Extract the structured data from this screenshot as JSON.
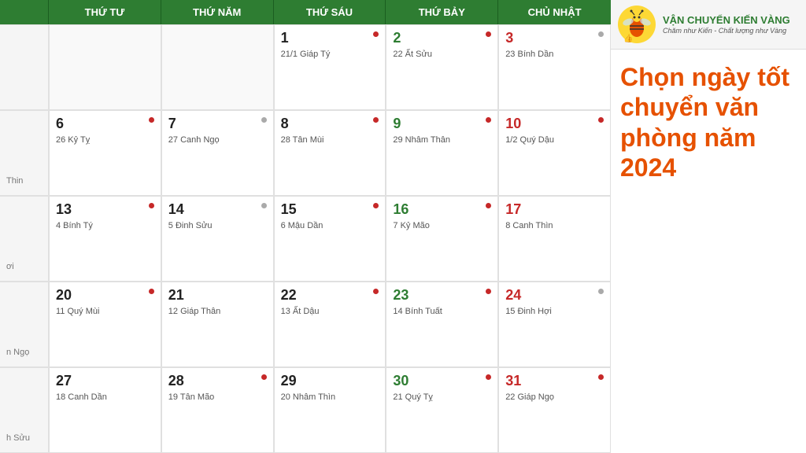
{
  "header": {
    "days": [
      "",
      "THỨ TƯ",
      "THỨ NĂM",
      "THỨ SÁU",
      "THỨ BẢY",
      "CHỦ NHẬT"
    ]
  },
  "logo": {
    "title": "VẬN CHUYỂN KIẾN VÀNG",
    "subtitle_line1": "Chăm như Kiến - Chất lượng như Vàng",
    "alt": "Logo Kiến Vàng"
  },
  "promo": {
    "text": "Chọn ngày tốt chuyển văn phòng năm 2024"
  },
  "rows": [
    {
      "partial": "",
      "cells": [
        {
          "day": "1",
          "lunar": "21/1 Giáp Tý",
          "dot": "red",
          "color": "normal"
        },
        {
          "day": "2",
          "lunar": "22 Ất Sửu",
          "dot": "red",
          "color": "green"
        },
        {
          "day": "3",
          "lunar": "23 Bính Dần",
          "dot": "gray",
          "color": "red"
        }
      ]
    },
    {
      "partial": "Thin",
      "cells": [
        {
          "day": "6",
          "lunar": "26 Kỷ Tỵ",
          "dot": "red",
          "color": "normal"
        },
        {
          "day": "7",
          "lunar": "27 Canh Ngọ",
          "dot": "gray",
          "color": "normal"
        },
        {
          "day": "8",
          "lunar": "28 Tân Mùi",
          "dot": "red",
          "color": "normal"
        },
        {
          "day": "9",
          "lunar": "29 Nhâm Thân",
          "dot": "red",
          "color": "green"
        },
        {
          "day": "10",
          "lunar": "1/2 Quý Dậu",
          "dot": "red",
          "color": "red"
        }
      ]
    },
    {
      "partial": "ơi",
      "cells": [
        {
          "day": "13",
          "lunar": "4 Bính Tý",
          "dot": "red",
          "color": "normal"
        },
        {
          "day": "14",
          "lunar": "5 Đinh Sửu",
          "dot": "gray",
          "color": "normal"
        },
        {
          "day": "15",
          "lunar": "6 Mậu Dần",
          "dot": "red",
          "color": "normal"
        },
        {
          "day": "16",
          "lunar": "7 Kỷ Mão",
          "dot": "red",
          "color": "green"
        },
        {
          "day": "17",
          "lunar": "8 Canh Thìn",
          "dot": "none",
          "color": "red"
        }
      ]
    },
    {
      "partial": "n Ngọ",
      "cells": [
        {
          "day": "20",
          "lunar": "11 Quý Mùi",
          "dot": "red",
          "color": "normal"
        },
        {
          "day": "21",
          "lunar": "12 Giáp Thân",
          "dot": "none",
          "color": "normal"
        },
        {
          "day": "22",
          "lunar": "13 Ất Dậu",
          "dot": "red",
          "color": "normal"
        },
        {
          "day": "23",
          "lunar": "14 Bính Tuất",
          "dot": "red",
          "color": "green"
        },
        {
          "day": "24",
          "lunar": "15 Đinh Hợi",
          "dot": "none",
          "color": "red"
        }
      ]
    },
    {
      "partial": "h Sửu",
      "cells": [
        {
          "day": "27",
          "lunar": "18 Canh Dần",
          "dot": "none",
          "color": "normal"
        },
        {
          "day": "28",
          "lunar": "19 Tân Mão",
          "dot": "red",
          "color": "normal"
        },
        {
          "day": "29",
          "lunar": "20 Nhâm Thìn",
          "dot": "none",
          "color": "normal"
        },
        {
          "day": "30",
          "lunar": "21 Quý Tỵ",
          "dot": "red",
          "color": "green"
        },
        {
          "day": "31",
          "lunar": "22 Giáp Ngọ",
          "dot": "red",
          "color": "red"
        }
      ]
    }
  ]
}
